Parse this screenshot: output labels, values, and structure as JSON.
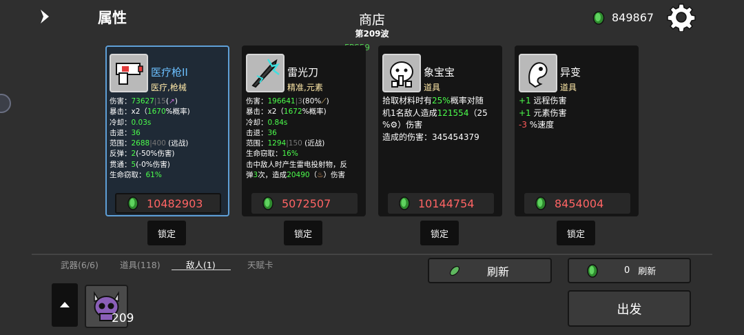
{
  "header": {
    "attributes_title": "属性",
    "shop_title": "商店",
    "wave_label": "第209波",
    "fps": "FPS59",
    "currency": "849867"
  },
  "cards": [
    {
      "name": "医疗枪II",
      "type": "医疗,枪械",
      "price": "10482903",
      "lock_label": "锁定"
    },
    {
      "name": "雷光刀",
      "type": "精准,元素",
      "price": "5072507",
      "lock_label": "锁定"
    },
    {
      "name": "象宝宝",
      "type": "道具",
      "price": "10144754",
      "lock_label": "锁定"
    },
    {
      "name": "异变",
      "type": "道具",
      "price": "8454004",
      "lock_label": "锁定"
    }
  ],
  "card1_stats": {
    "damage_label": "伤害：",
    "damage_value": "73627",
    "damage_sep": "|",
    "damage_base": "15",
    "damage_suffix": "(",
    "damage_close": ")",
    "crit_label": "暴击：x2（",
    "crit_value": "1670",
    "crit_suffix": "%概率)",
    "cooldown_label": "冷却：",
    "cooldown_value": "0.03s",
    "knockback_label": "击退：",
    "knockback_value": "36",
    "range_label": "范围：",
    "range_value": "2688",
    "range_sep": "|",
    "range_base": "400",
    "range_suffix": " (远战)",
    "bounce_label": "反弹：",
    "bounce_value": "2",
    "bounce_suffix": "(-50%伤害)",
    "pierce_label": "贯通：",
    "pierce_value": "5",
    "pierce_suffix": "(-0%伤害)",
    "lifesteal_label": "生命窃取：",
    "lifesteal_value": "61%"
  },
  "card2_stats": {
    "damage_label": "伤害：",
    "damage_value": "196641",
    "damage_sep": "|",
    "damage_base": "3",
    "damage_suffix": "(80%",
    "damage_close": ")",
    "crit_label": "暴击：x2（",
    "crit_value": "1672",
    "crit_suffix": "%概率)",
    "cooldown_label": "冷却：",
    "cooldown_value": "0.84s",
    "knockback_label": "击退：",
    "knockback_value": "36",
    "range_label": "范围：",
    "range_value": "1294",
    "range_sep": "|",
    "range_base": "150",
    "range_suffix": " (近战)",
    "lifesteal_label": "生命窃取：",
    "lifesteal_value": "16%",
    "effect_line1": "击中敌人时产生雷电投射物，反",
    "effect_line2a": "弹",
    "effect_bounces": "3",
    "effect_line2b": "次，造成",
    "effect_damage": "20490",
    "effect_line2c": "（",
    "effect_line2d": "）伤害"
  },
  "card3_desc": {
    "line1a": "拾取材料时有",
    "chance": "25%",
    "line1b": "概率对随",
    "line2a": "机1名敌人造成",
    "damage": "121554",
    "line2b": "（25",
    "line3a": "%",
    "line3b": "）伤害",
    "dealt_label": "造成的伤害：",
    "dealt_value": "345454379"
  },
  "card4_desc": {
    "plus1": "+1",
    "ranged": " 远程伤害",
    "plus2": "+1",
    "elemental": " 元素伤害",
    "minus": "-3",
    "speed": " %速度"
  },
  "tabs": [
    "武器(6/6)",
    "道具(118)",
    "敌人(1)",
    "天赋卡"
  ],
  "enemy_count": "209",
  "refresh_label": "刷新",
  "refresh_free_count": "0",
  "refresh_free_label": "刷新",
  "depart_label": "出发",
  "colors": {
    "accent_blue": "#6cc0ff",
    "positive_green": "#4cff4c",
    "price_red": "#ff6464",
    "coin_green": "#3fae3f"
  }
}
